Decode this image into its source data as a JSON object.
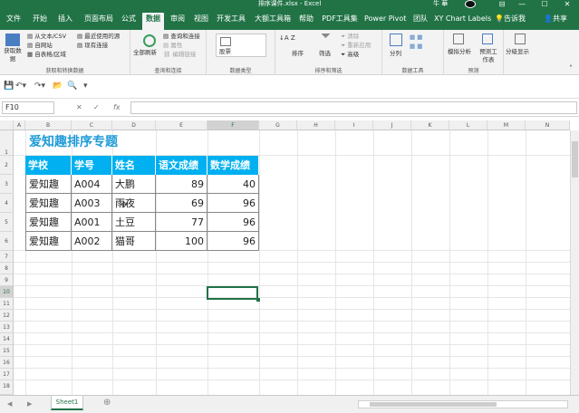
{
  "window": {
    "title": "排序课件.xlsx - Excel",
    "user": "牛 華",
    "controls": [
      "⊟",
      "—",
      "☐",
      "✕"
    ]
  },
  "tabs": [
    {
      "label": "文件"
    },
    {
      "label": "开始"
    },
    {
      "label": "插入"
    },
    {
      "label": "页面布局"
    },
    {
      "label": "公式"
    },
    {
      "label": "数据",
      "active": true
    },
    {
      "label": "审阅"
    },
    {
      "label": "视图"
    },
    {
      "label": "开发工具"
    },
    {
      "label": "大额工具箱"
    },
    {
      "label": "帮助"
    },
    {
      "label": "PDF工具集"
    },
    {
      "label": "Power Pivot"
    },
    {
      "label": "团队"
    },
    {
      "label": "XY Chart Labels"
    }
  ],
  "tell_me": "告诉我",
  "share": "共享",
  "ribbon": {
    "get_data": {
      "big": "获取数据",
      "items": [
        "从文本/CSV",
        "自网站",
        "自表格/区域",
        "最近使用的源",
        "现有连接"
      ],
      "label": "获取和转换数据"
    },
    "queries": {
      "big": "全部刷新",
      "items": [
        "查询和连接",
        "属性",
        "编辑链接"
      ],
      "label": "查询和连接"
    },
    "data_types": {
      "big": "股票",
      "label": "数据类型"
    },
    "sort_filter": {
      "sort": "排序",
      "filter": "筛选",
      "items": [
        "清除",
        "重新应用",
        "高级"
      ],
      "label": "排序和筛选"
    },
    "data_tools": {
      "big": "分列",
      "label": "数据工具"
    },
    "forecast": {
      "items": [
        "模拟分析",
        "预测工作表"
      ],
      "label": "预测"
    },
    "outline": {
      "big": "分级显示"
    }
  },
  "formula_bar": {
    "name_box": "F10",
    "cancel": "✕",
    "enter": "✓",
    "fx": "fx",
    "value": ""
  },
  "columns": [
    "A",
    "B",
    "C",
    "D",
    "E",
    "F",
    "G",
    "H",
    "I",
    "J",
    "K",
    "L",
    "M",
    "N"
  ],
  "rows": [
    "1",
    "2",
    "3",
    "4",
    "5",
    "6",
    "7",
    "8",
    "9",
    "10",
    "11",
    "12",
    "13",
    "14",
    "15",
    "16",
    "17",
    "18",
    "19",
    "20",
    "21",
    "22",
    "23"
  ],
  "sheet": {
    "title": "爱知趣排序专题",
    "headers": [
      "学校",
      "学号",
      "姓名",
      "语文成绩",
      "数学成绩"
    ],
    "data": [
      [
        "爱知趣",
        "A004",
        "大鹏",
        "89",
        "40"
      ],
      [
        "爱知趣",
        "A003",
        "雨夜",
        "69",
        "96"
      ],
      [
        "爱知趣",
        "A001",
        "土豆",
        "77",
        "96"
      ],
      [
        "爱知趣",
        "A002",
        "猫哥",
        "100",
        "96"
      ]
    ]
  },
  "sheet_tabs": {
    "active": "Sheet1",
    "add": "⊕",
    "prev": "◀",
    "next": "▶"
  },
  "colors": {
    "excel_green": "#217346",
    "table_header": "#00b0f0",
    "title_blue": "#1e9bd7"
  }
}
